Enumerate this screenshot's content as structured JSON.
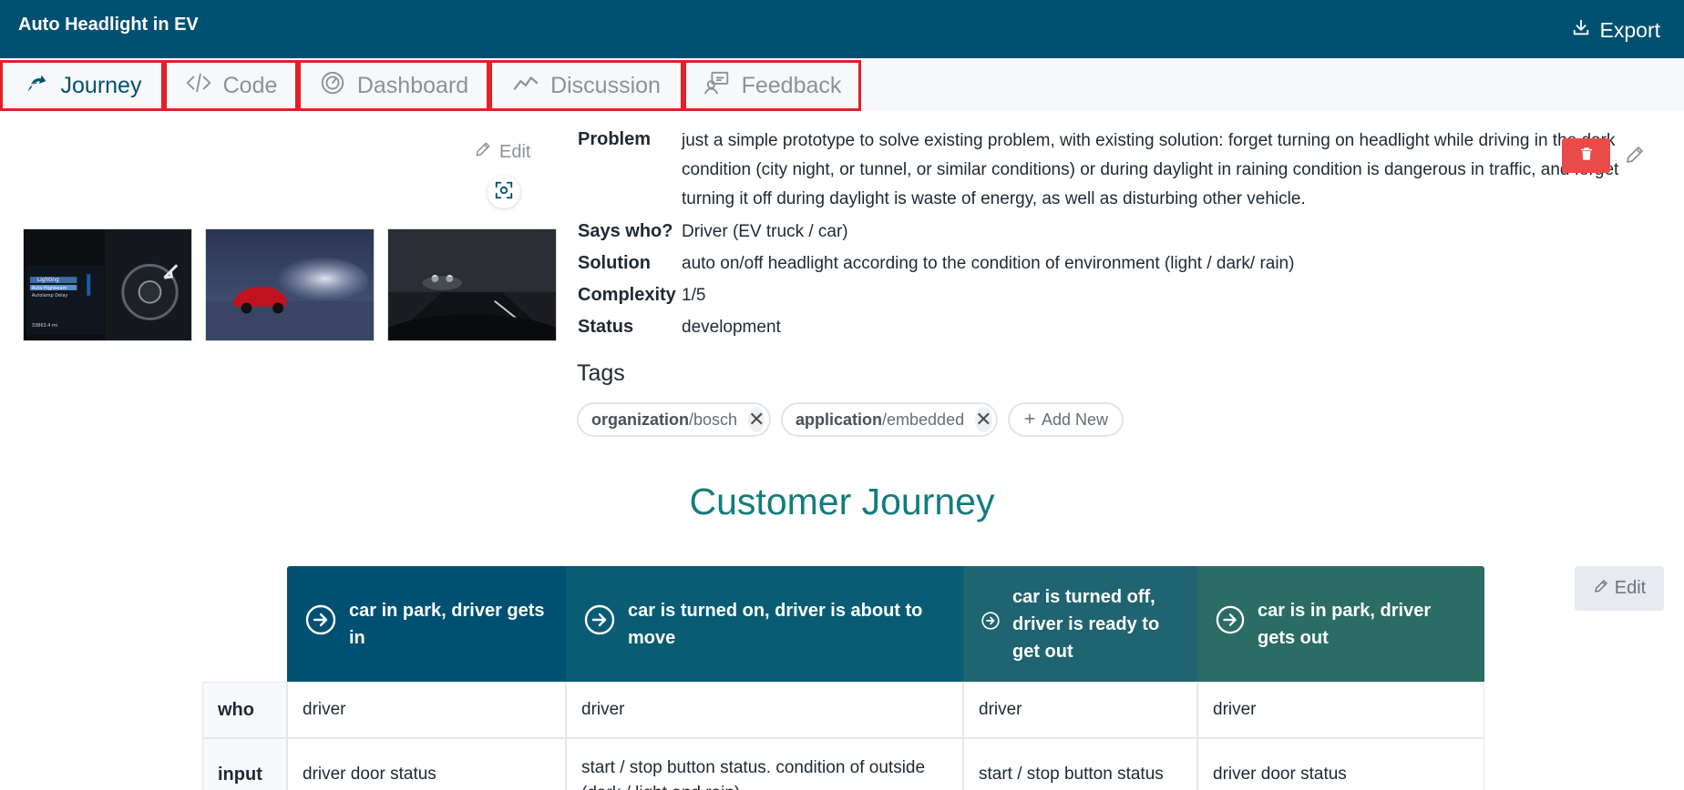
{
  "header": {
    "title": "Auto Headlight in EV",
    "export_label": "Export"
  },
  "tabs": [
    {
      "label": "Journey",
      "icon": "journey-icon",
      "active": true
    },
    {
      "label": "Code",
      "icon": "code-icon",
      "active": false
    },
    {
      "label": "Dashboard",
      "icon": "dashboard-icon",
      "active": false
    },
    {
      "label": "Discussion",
      "icon": "discussion-icon",
      "active": false
    },
    {
      "label": "Feedback",
      "icon": "feedback-icon",
      "active": false
    }
  ],
  "gallery": {
    "edit_label": "Edit",
    "images": [
      "dashboard-lighting-menu-image",
      "red-car-headlights-night-image",
      "car-headlights-dark-road-image"
    ],
    "image_text": {
      "menu_title": "Lighting",
      "menu_item_1": "Auto Highbeam",
      "menu_item_2": "Autolamp Delay",
      "odometer": "33863.4 mi"
    }
  },
  "info": {
    "problem_label": "Problem",
    "problem_value": "just a simple prototype to solve existing problem, with existing solution: forget turning on headlight while driving in the dark condition (city night, or tunnel, or similar conditions) or during daylight in raining condition is dangerous in traffic, and forget turning it off during daylight is waste of energy, as well as disturbing other vehicle.",
    "says_who_label": "Says who?",
    "says_who_value": "Driver (EV truck / car)",
    "solution_label": "Solution",
    "solution_value": "auto on/off headlight according to the condition of environment (light / dark/ rain)",
    "complexity_label": "Complexity",
    "complexity_value": "1/5",
    "status_label": "Status",
    "status_value": "development"
  },
  "tags": {
    "title": "Tags",
    "items": [
      {
        "key": "organization",
        "value": "/bosch"
      },
      {
        "key": "application",
        "value": "/embedded"
      }
    ],
    "add_new_label": "Add New",
    "remove_symbol": "✕"
  },
  "journey": {
    "title": "Customer Journey",
    "edit_label": "Edit",
    "stages": [
      "car in park, driver gets in",
      "car is turned on, driver is about to move",
      "car is turned off, driver is ready to get out",
      "car is in park, driver gets out"
    ],
    "rows": [
      {
        "label": "who",
        "cells": [
          "driver",
          "driver",
          "driver",
          "driver"
        ]
      },
      {
        "label": "input",
        "cells": [
          "driver door status",
          "start / stop button status. condition of outside (dark / light and rain)",
          "start / stop button status",
          "driver door status"
        ]
      }
    ]
  },
  "colors": {
    "header_bg": "#005072",
    "tab_highlight": "#e0202a",
    "journey_title": "#127c7c",
    "delete": "#e94a4a"
  }
}
